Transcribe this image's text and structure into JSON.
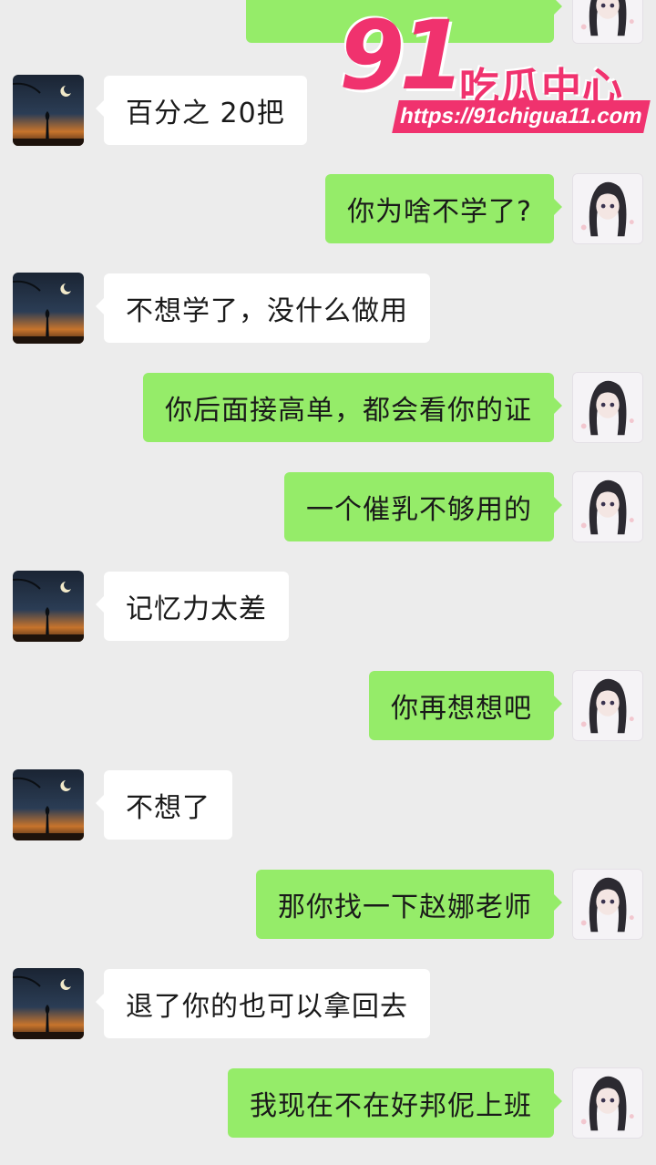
{
  "watermark": {
    "number": "91",
    "name": "吃瓜中心",
    "url": "https://91chigua11.com"
  },
  "messages": [
    {
      "side": "right",
      "text": ""
    },
    {
      "side": "left",
      "text": "百分之 20把"
    },
    {
      "side": "right",
      "text": "你为啥不学了?"
    },
    {
      "side": "left",
      "text": "不想学了，没什么做用"
    },
    {
      "side": "right",
      "text": "你后面接高单，都会看你的证"
    },
    {
      "side": "right",
      "text": "一个催乳不够用的"
    },
    {
      "side": "left",
      "text": "记忆力太差"
    },
    {
      "side": "right",
      "text": "你再想想吧"
    },
    {
      "side": "left",
      "text": "不想了"
    },
    {
      "side": "right",
      "text": "那你找一下赵娜老师"
    },
    {
      "side": "left",
      "text": "退了你的也可以拿回去"
    },
    {
      "side": "right",
      "text": "我现在不在好邦伲上班"
    }
  ],
  "avatars": {
    "left_icon": "night-silhouette-avatar",
    "right_icon": "anime-girl-avatar"
  }
}
